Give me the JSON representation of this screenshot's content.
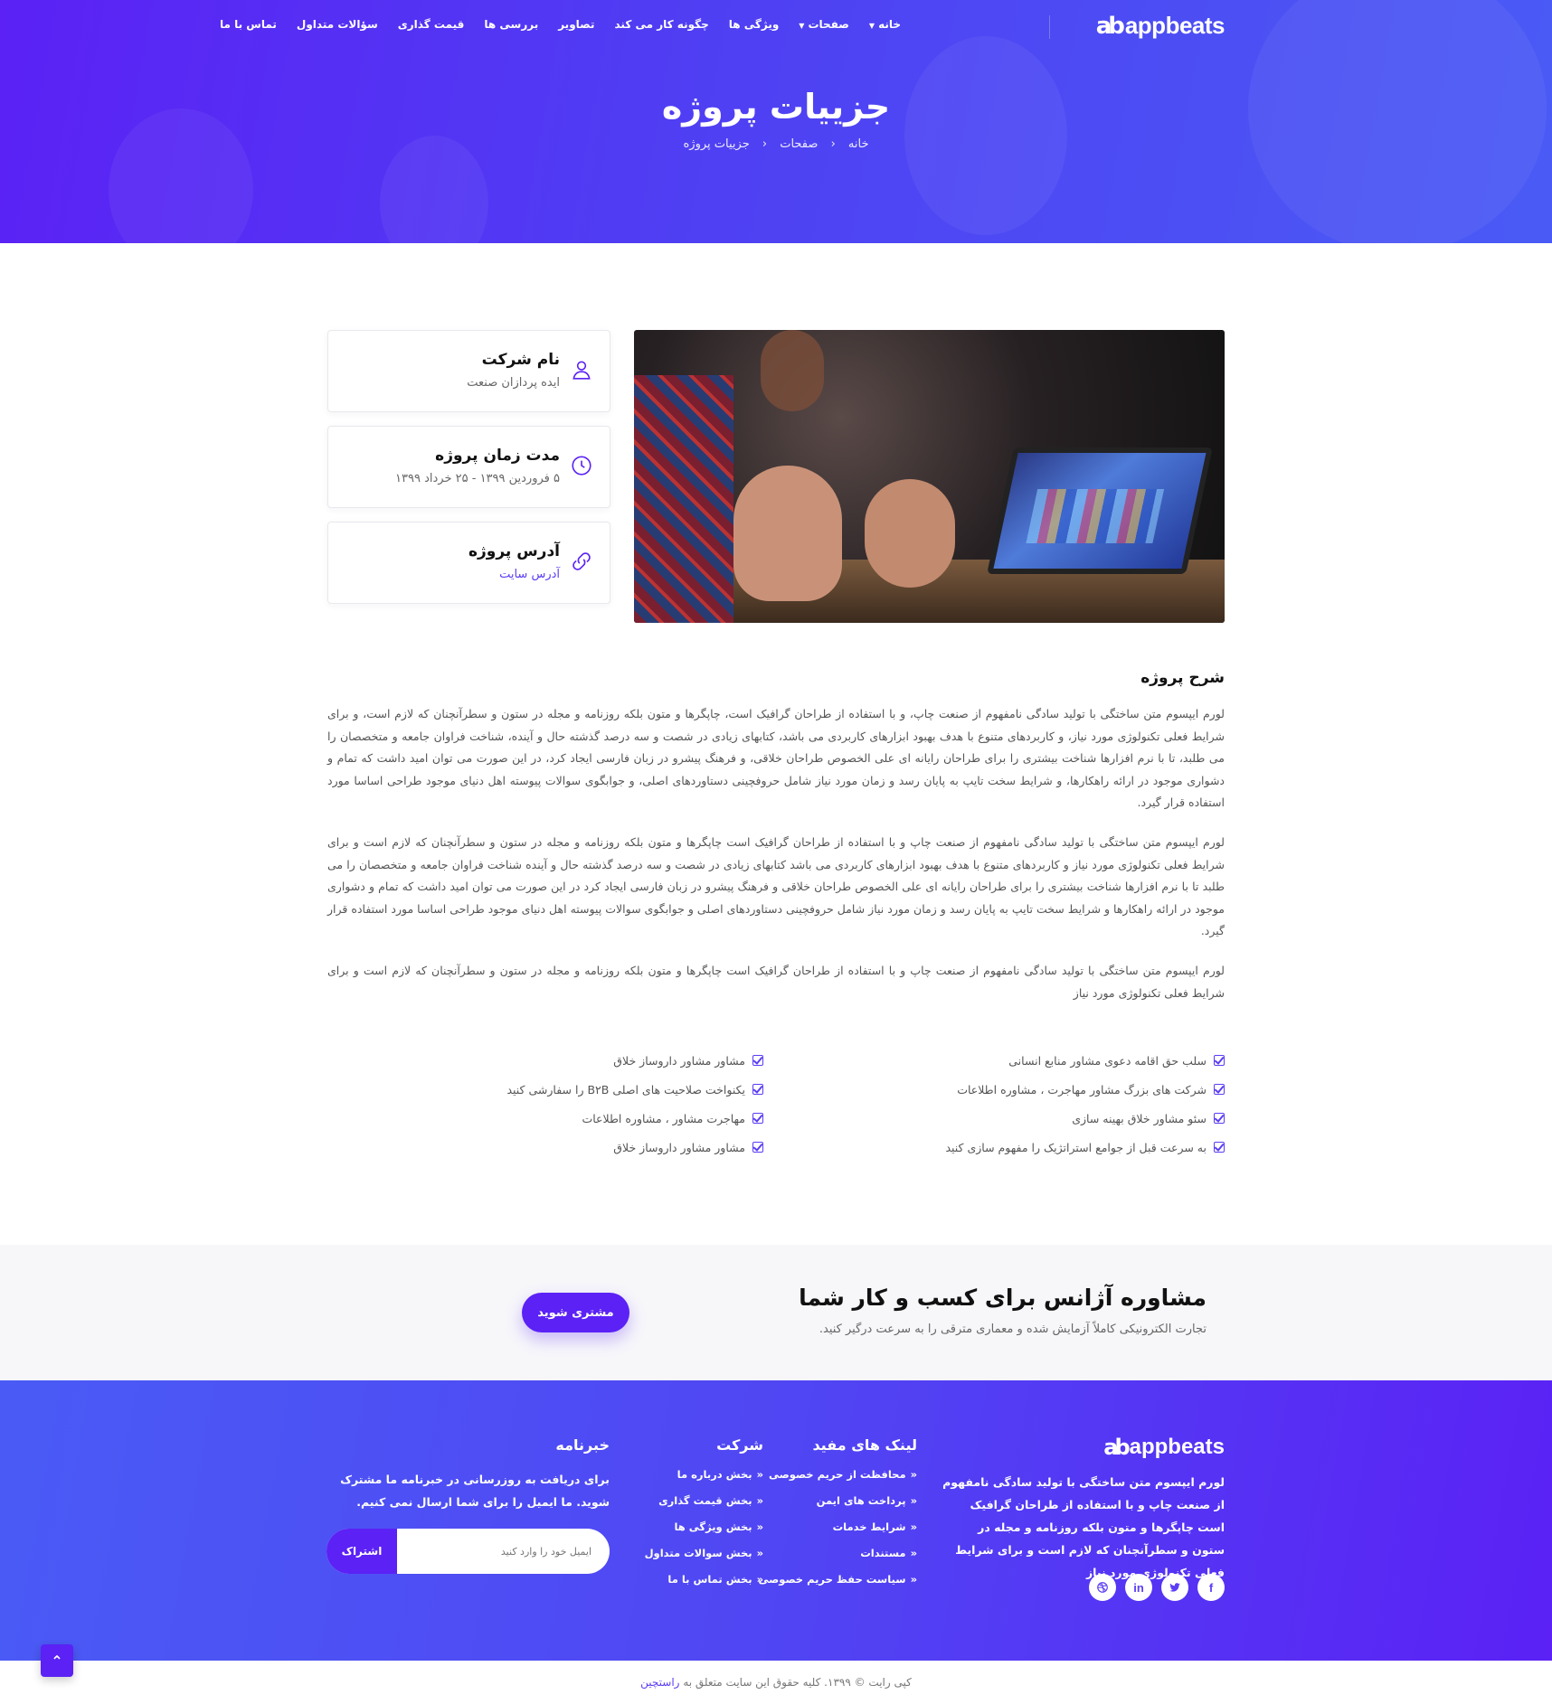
{
  "brand": {
    "name": "appbeats",
    "mark": "ab"
  },
  "nav": {
    "items": [
      {
        "label": "خانه",
        "dropdown": true
      },
      {
        "label": "صفحات",
        "dropdown": true
      },
      {
        "label": "ویژگی ها",
        "dropdown": false
      },
      {
        "label": "چگونه کار می کند",
        "dropdown": false
      },
      {
        "label": "تصاویر",
        "dropdown": false
      },
      {
        "label": "بررسی ها",
        "dropdown": false
      },
      {
        "label": "قیمت گذاری",
        "dropdown": false
      },
      {
        "label": "سؤالات متداول",
        "dropdown": false
      },
      {
        "label": "تماس با ما",
        "dropdown": false
      }
    ]
  },
  "hero": {
    "title": "جزییات پروژه",
    "breadcrumb": [
      "خانه",
      "صفحات",
      "جزییات پروژه"
    ]
  },
  "info_cards": [
    {
      "title": "نام شرکت",
      "value": "ایده پردازان صنعت",
      "icon": "user-icon"
    },
    {
      "title": "مدت زمان پروژه",
      "value": "۵ فروردین ۱۳۹۹ - ۲۵ خرداد ۱۳۹۹",
      "icon": "clock-icon"
    },
    {
      "title": "آدرس پروژه",
      "value": "آدرس سایت",
      "icon": "link-icon"
    }
  ],
  "description": {
    "title": "شرح پروژه",
    "paragraphs": [
      "لورم ایپسوم متن ساختگی با تولید سادگی نامفهوم از صنعت چاپ، و با استفاده از طراحان گرافیک است، چاپگرها و متون بلکه روزنامه و مجله در ستون و سطرآنچنان که لازم است، و برای شرایط فعلی تکنولوژی مورد نیاز، و کاربردهای متنوع با هدف بهبود ابزارهای کاربردی می باشد، کتابهای زیادی در شصت و سه درصد گذشته حال و آینده، شناخت فراوان جامعه و متخصصان را می طلبد، تا با نرم افزارها شناخت بیشتری را برای طراحان رایانه ای علی الخصوص طراحان خلاقی، و فرهنگ پیشرو در زبان فارسی ایجاد کرد، در این صورت می توان امید داشت که تمام و دشواری موجود در ارائه راهکارها، و شرایط سخت تایپ به پایان رسد و زمان مورد نیاز شامل حروفچینی دستاوردهای اصلی، و جوابگوی سوالات پیوسته اهل دنیای موجود طراحی اساسا مورد استفاده قرار گیرد.",
      "لورم ایپسوم متن ساختگی با تولید سادگی نامفهوم از صنعت چاپ و با استفاده از طراحان گرافیک است چاپگرها و متون بلکه روزنامه و مجله در ستون و سطرآنچنان که لازم است و برای شرایط فعلی تکنولوژی مورد نیاز و کاربردهای متنوع با هدف بهبود ابزارهای کاربردی می باشد کتابهای زیادی در شصت و سه درصد گذشته حال و آینده شناخت فراوان جامعه و متخصصان را می طلبد تا با نرم افزارها شناخت بیشتری را برای طراحان رایانه ای علی الخصوص طراحان خلاقی و فرهنگ پیشرو در زبان فارسی ایجاد کرد در این صورت می توان امید داشت که تمام و دشواری موجود در ارائه راهکارها و شرایط سخت تایپ به پایان رسد و زمان مورد نیاز شامل حروفچینی دستاوردهای اصلی و جوابگوی سوالات پیوسته اهل دنیای موجود طراحی اساسا مورد استفاده قرار گیرد.",
      "لورم ایپسوم متن ساختگی با تولید سادگی نامفهوم از صنعت چاپ و با استفاده از طراحان گرافیک است چاپگرها و متون بلکه روزنامه و مجله در ستون و سطرآنچنان که لازم است و برای شرایط فعلی تکنولوژی مورد نیاز"
    ]
  },
  "checklist": {
    "right": [
      "سلب حق اقامه دعوی مشاور منابع انسانی",
      "شرکت های بزرگ مشاور مهاجرت ، مشاوره اطلاعات",
      "سئو مشاور خلاق بهینه سازی",
      "به سرعت قبل از جوامع استراتژیک را مفهوم سازی کنید"
    ],
    "left": [
      "مشاور مشاور داروساز خلاق",
      "یکنواخت صلاحیت های اصلی B۲B را سفارشی کنید",
      "مهاجرت مشاور ، مشاوره اطلاعات",
      "مشاور مشاور داروساز خلاق"
    ]
  },
  "cta": {
    "title": "مشاوره آژانس برای کسب و کار شما",
    "subtitle": "تجارت الکترونیکی کاملاً آزمایش شده و معماری مترقی را به سرعت درگیر کنید.",
    "button": "مشتری شوید"
  },
  "footer": {
    "about": "لورم ایپسوم متن ساختگی با تولید سادگی نامفهوم از صنعت چاپ و با استفاده از طراحان گرافیک است چاپگرها و متون بلکه روزنامه و مجله در ستون و سطرآنچنان که لازم است و برای شرایط فعلی تکنولوژی مورد نیاز",
    "socials": [
      "facebook-icon",
      "twitter-icon",
      "linkedin-icon",
      "dribbble-icon"
    ],
    "useful_links": {
      "title": "لینک های مفید",
      "items": [
        "محافظت از حریم خصوصی",
        "پرداخت های ایمن",
        "شرایط خدمات",
        "مستندات",
        "سیاست حفظ حریم خصوصی"
      ]
    },
    "company": {
      "title": "شرکت",
      "items": [
        "بخش درباره ما",
        "بخش قیمت گذاری",
        "بخش ویژگی ها",
        "بخش سوالات متداول",
        "بخش تماس با ما"
      ]
    },
    "newsletter": {
      "title": "خبرنامه",
      "text": "برای دریافت به روزرسانی در خبرنامه ما مشترک شوید. ما ایمیل را برای شما ارسال نمی کنیم.",
      "placeholder": "ایمیل خود را وارد کنید",
      "button": "اشتراک"
    }
  },
  "copyright": {
    "text": "کپی رایت © ۱۳۹۹. کلیه حقوق این سایت متعلق به",
    "brand": "راستچین"
  },
  "colors": {
    "primary": "#5b21f5",
    "accent": "#4a5bf5"
  }
}
